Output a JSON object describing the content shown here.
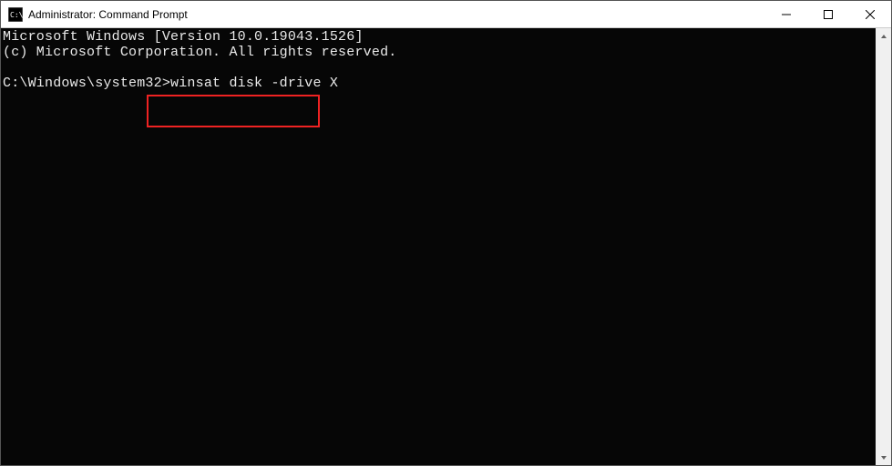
{
  "window": {
    "title": "Administrator: Command Prompt"
  },
  "terminal": {
    "line1": "Microsoft Windows [Version 10.0.19043.1526]",
    "line2": "(c) Microsoft Corporation. All rights reserved.",
    "blank": "",
    "prompt": "C:\\Windows\\system32>",
    "command": "winsat disk -drive X"
  }
}
